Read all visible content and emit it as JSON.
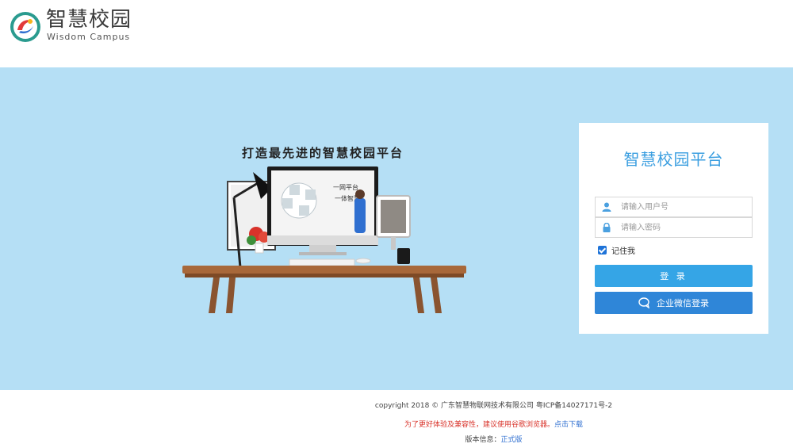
{
  "header": {
    "logo_cn": "智慧校园",
    "logo_en": "Wisdom Campus"
  },
  "banner": {
    "slogan": "打造最先进的智慧校园平台",
    "screen_text_1": "一网平台",
    "screen_text_2": "一体智慧"
  },
  "login": {
    "title": "智慧校园平台",
    "username_placeholder": "请输入用户号",
    "password_placeholder": "请输入密码",
    "remember_label": "记住我",
    "remember_checked": true,
    "login_button": "登 录",
    "wechat_button": "企业微信登录"
  },
  "footer": {
    "copyright": "copyright 2018 © 广东智慧物联网技术有限公司 粤ICP备14027171号-2",
    "notice_text": "为了更好体验及兼容性，建议使用谷歌浏览器。",
    "notice_link": "点击下载",
    "version_label": "版本信息：",
    "version_value": "正式版"
  },
  "colors": {
    "banner_bg": "#b5dff5",
    "title_blue": "#3a9ee0",
    "login_button": "#35a5e6",
    "wechat_button": "#2f86d8",
    "notice_red": "#d9342b"
  }
}
